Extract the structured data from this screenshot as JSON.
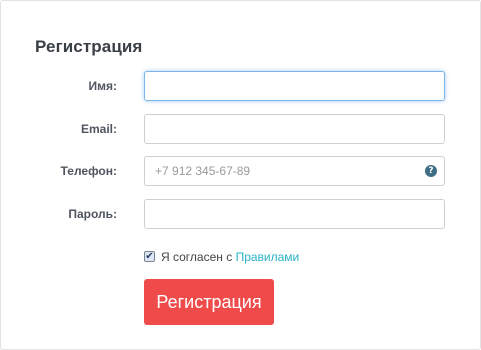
{
  "form": {
    "title": "Регистрация",
    "fields": {
      "name": {
        "label": "Имя:",
        "value": "",
        "placeholder": ""
      },
      "email": {
        "label": "Email:",
        "value": "",
        "placeholder": ""
      },
      "phone": {
        "label": "Телефон:",
        "value": "",
        "placeholder": "+7 912 345-67-89",
        "help_icon": "question-circle-icon"
      },
      "password": {
        "label": "Пароль:",
        "value": "",
        "placeholder": ""
      }
    },
    "agreement": {
      "checked": true,
      "text": "Я согласен с",
      "link_text": "Правилами"
    },
    "submit_label": "Регистрация"
  },
  "colors": {
    "title": "#3a3f46",
    "link": "#2ab3c7",
    "submit_bg": "#ef4b4b",
    "focus_border": "#7eb6e8",
    "help_icon": "#3e6e86"
  }
}
